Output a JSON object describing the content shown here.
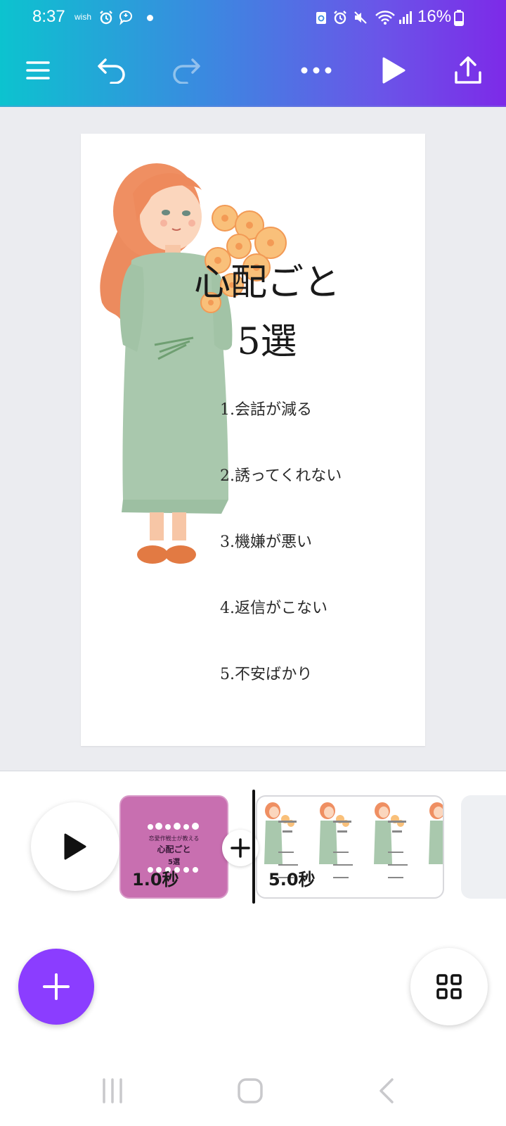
{
  "status_bar": {
    "time": "8:37",
    "carrier": "wish",
    "battery": "16%"
  },
  "toolbar": {
    "menu_icon": "menu-icon",
    "undo_icon": "undo-icon",
    "redo_icon": "redo-icon",
    "more_icon": "more-icon",
    "play_icon": "play-icon",
    "share_icon": "share-icon"
  },
  "design": {
    "title_line1": "心配ごと",
    "title_line2": "5選",
    "items": [
      "1.会話が減る",
      "2.誘ってくれない",
      "3.機嫌が悪い",
      "4.返信がこない",
      "5.不安ばかり"
    ]
  },
  "timeline": {
    "clips": [
      {
        "duration": "1.0秒",
        "mini_line1": "恋愛作戦士が教える",
        "mini_line2": "心配ごと",
        "mini_line3": "5選"
      },
      {
        "duration": "5.0秒"
      }
    ]
  },
  "colors": {
    "accent": "#8b3dff",
    "clip1_bg": "#c86fb0"
  }
}
